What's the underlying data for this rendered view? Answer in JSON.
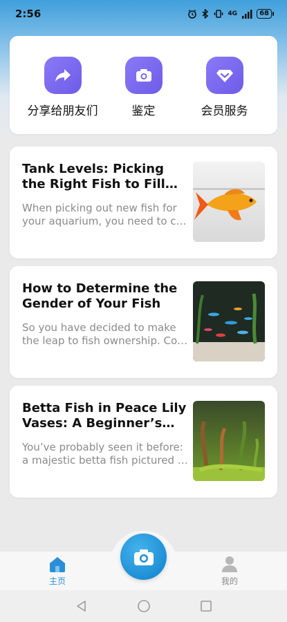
{
  "status_bar": {
    "time": "2:56",
    "signal_text": "4G",
    "battery": "68"
  },
  "actions": [
    {
      "label": "分享给朋友们",
      "icon": "share-arrow-icon"
    },
    {
      "label": "鉴定",
      "icon": "camera-icon"
    },
    {
      "label": "会员服务",
      "icon": "diamond-icon"
    }
  ],
  "articles": [
    {
      "title": "Tank Levels: Picking the Right Fish to Fill Your A…",
      "desc": "When picking out new fish for your aquarium, you need to c…",
      "thumb": "orange-fish-photo"
    },
    {
      "title": "How to Determine the Gender of Your Fish",
      "desc": "So you have decided to make the leap to fish ownership. Co…",
      "thumb": "aquarium-fish-photo"
    },
    {
      "title": "Betta Fish in Peace Lily Vases: A Beginner’s Mist…",
      "desc": "You’ve probably seen it before: a majestic betta fish pictured …",
      "thumb": "aquarium-plants-photo"
    }
  ],
  "tab_bar": {
    "home_label": "主页",
    "mine_label": "我的",
    "active_color": "#2a8fd8",
    "inactive_color": "#8a8a8a"
  },
  "colors": {
    "accent_purple": "#7a68f0",
    "fab_blue": "#1d8fd6"
  }
}
